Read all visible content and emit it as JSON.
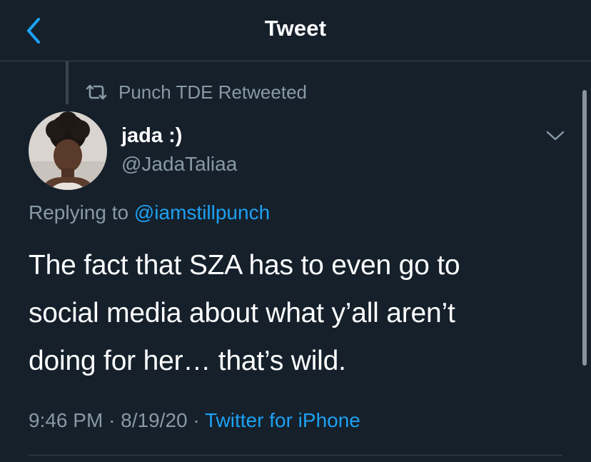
{
  "header": {
    "title": "Tweet",
    "back_icon": "chevron-left-icon"
  },
  "retweet": {
    "icon": "retweet-icon",
    "label": "Punch TDE Retweeted"
  },
  "tweet": {
    "author_name": "jada :)",
    "author_handle": "@JadaTaliaa",
    "replying_prefix": "Replying to",
    "replying_to": "@iamstillpunch",
    "text": "The fact that SZA has to even go to\nsocial media about what y’all aren’t\ndoing for her… that’s wild.",
    "time": "9:46 PM",
    "date": "8/19/20",
    "separator": "·",
    "source": "Twitter for iPhone",
    "menu_icon": "chevron-down-icon"
  },
  "colors": {
    "background": "#15202b",
    "accent": "#1da1f2",
    "secondary_text": "#8899a6",
    "divider": "#38444d"
  }
}
